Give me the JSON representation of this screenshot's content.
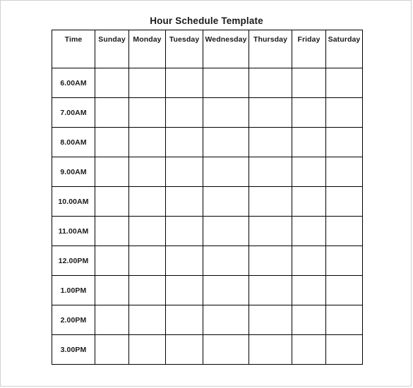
{
  "document": {
    "title": "Hour Schedule Template"
  },
  "table": {
    "columns": [
      {
        "key": "time",
        "label": "Time"
      },
      {
        "key": "sunday",
        "label": "Sunday"
      },
      {
        "key": "monday",
        "label": "Monday"
      },
      {
        "key": "tuesday",
        "label": "Tuesday"
      },
      {
        "key": "wednesday",
        "label": "Wednesday"
      },
      {
        "key": "thursday",
        "label": "Thursday"
      },
      {
        "key": "friday",
        "label": "Friday"
      },
      {
        "key": "saturday",
        "label": "Saturday"
      }
    ],
    "rows": [
      {
        "time": "6.00AM",
        "cells": [
          "",
          "",
          "",
          "",
          "",
          "",
          ""
        ]
      },
      {
        "time": "7.00AM",
        "cells": [
          "",
          "",
          "",
          "",
          "",
          "",
          ""
        ]
      },
      {
        "time": "8.00AM",
        "cells": [
          "",
          "",
          "",
          "",
          "",
          "",
          ""
        ]
      },
      {
        "time": "9.00AM",
        "cells": [
          "",
          "",
          "",
          "",
          "",
          "",
          ""
        ]
      },
      {
        "time": "10.00AM",
        "cells": [
          "",
          "",
          "",
          "",
          "",
          "",
          ""
        ]
      },
      {
        "time": "11.00AM",
        "cells": [
          "",
          "",
          "",
          "",
          "",
          "",
          ""
        ]
      },
      {
        "time": "12.00PM",
        "cells": [
          "",
          "",
          "",
          "",
          "",
          "",
          ""
        ]
      },
      {
        "time": "1.00PM",
        "cells": [
          "",
          "",
          "",
          "",
          "",
          "",
          ""
        ]
      },
      {
        "time": "2.00PM",
        "cells": [
          "",
          "",
          "",
          "",
          "",
          "",
          ""
        ]
      },
      {
        "time": "3.00PM",
        "cells": [
          "",
          "",
          "",
          "",
          "",
          "",
          ""
        ]
      }
    ]
  },
  "colors": {
    "text": "#1a1a1a",
    "border": "#000000",
    "page_background": "#ffffff",
    "frame_border": "#d0d0d0"
  }
}
